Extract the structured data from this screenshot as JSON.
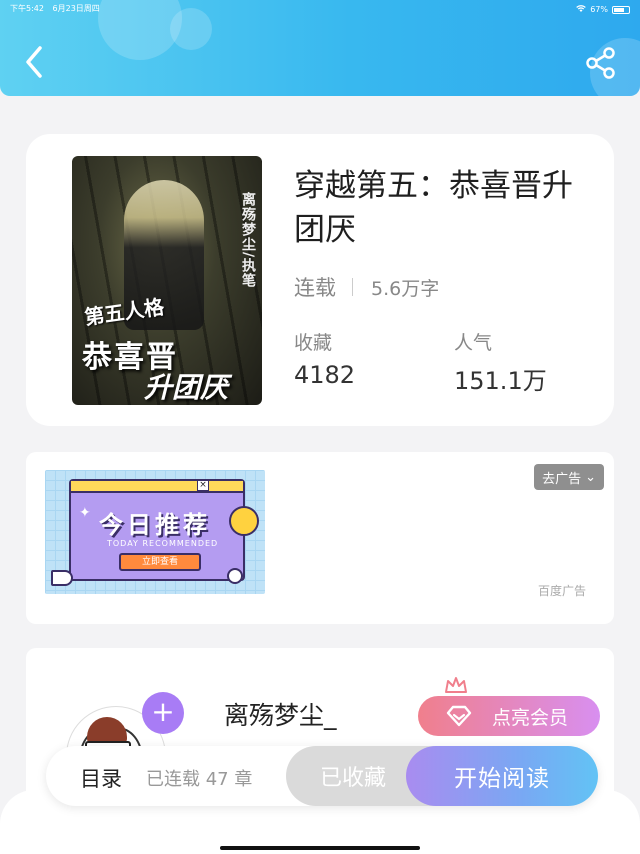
{
  "status_bar": {
    "time": "下午5:42",
    "date": "6月23日周四",
    "battery": "67%"
  },
  "header": {
    "back_icon": "chevron-left-icon",
    "share_icon": "share-icon",
    "colors": {
      "start": "#5fd1f2",
      "end": "#2ea9ee"
    }
  },
  "book": {
    "title": "穿越第五：恭喜晋升团厌",
    "status": "连载",
    "word_count": "5.6万字",
    "favorites_label": "收藏",
    "favorites_value": "4182",
    "popularity_label": "人气",
    "popularity_value": "151.1万",
    "cover": {
      "vertical_text": "离殇梦尘/执笔",
      "line1": "第五人格",
      "line2": "恭喜晋",
      "line3": "升团厌"
    }
  },
  "ad": {
    "remove_label": "去广告",
    "source": "百度广告",
    "banner_main": "今日推荐",
    "banner_sub": "TODAY RECOMMENDED",
    "banner_button": "立即查看"
  },
  "author": {
    "name": "离殇梦尘_",
    "follow_symbol": "+",
    "vip_label": "点亮会员",
    "vip_colors": {
      "start": "#f07f8c",
      "end": "#d88ff0"
    }
  },
  "action_bar": {
    "toc_label": "目录",
    "chapters": "已连载 47 章",
    "collected_label": "已收藏",
    "read_label": "开始阅读",
    "read_colors": {
      "start": "#a98cf0",
      "end": "#62c3f5"
    }
  }
}
